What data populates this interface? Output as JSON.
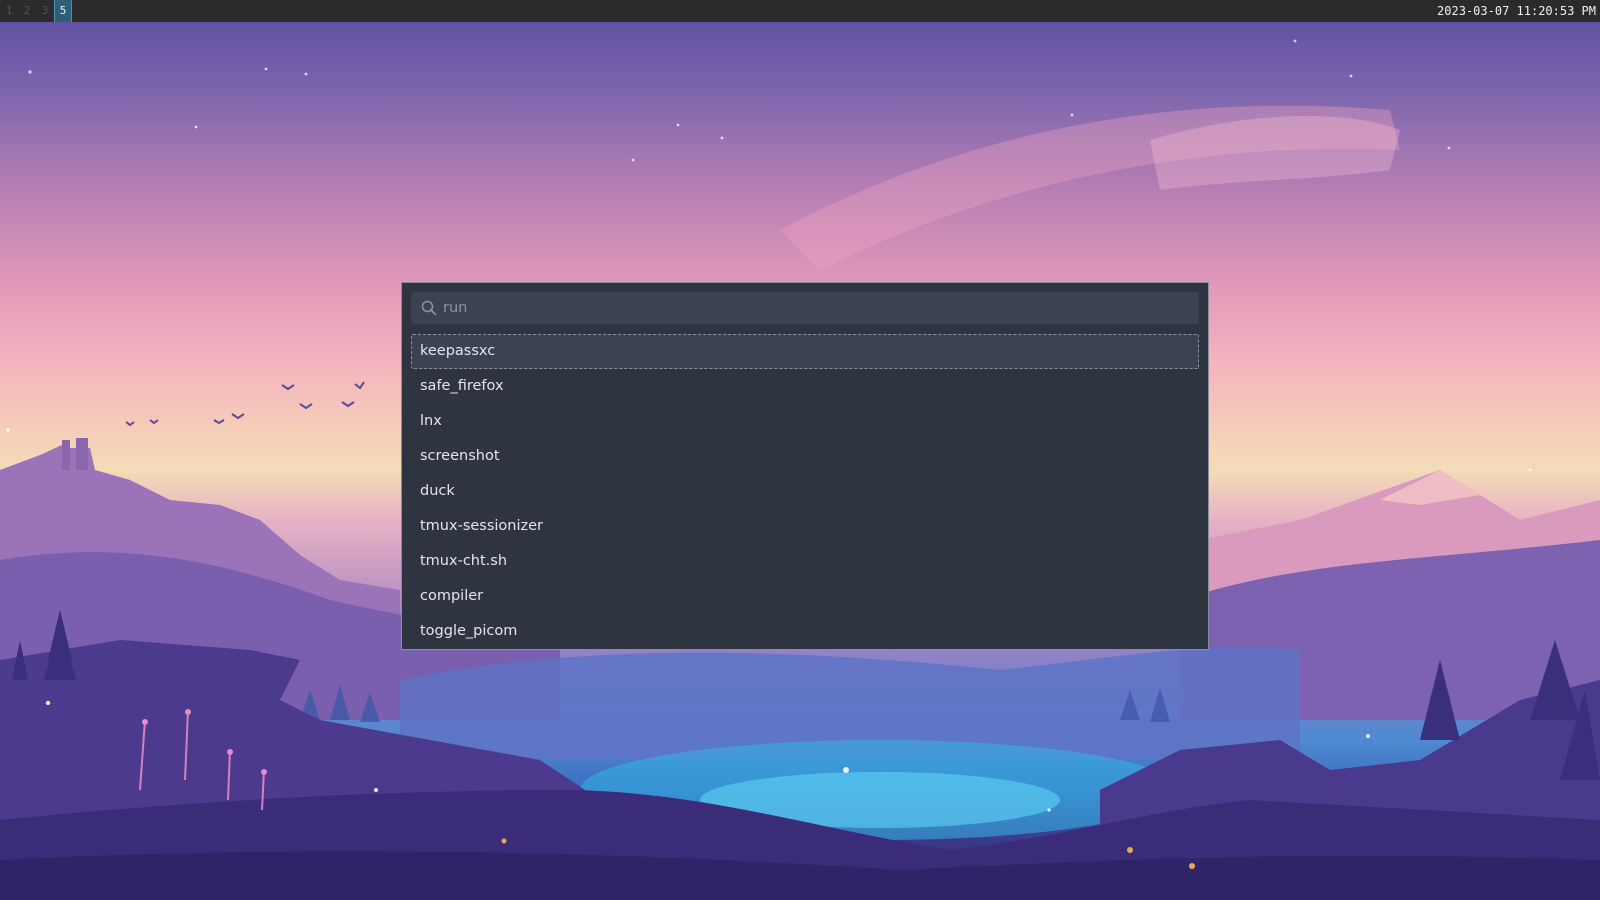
{
  "topbar": {
    "workspaces": [
      "1",
      "2",
      "3",
      "4",
      "5"
    ],
    "active_workspace": "5",
    "clock": "2023-03-07 11:20:53 PM"
  },
  "launcher": {
    "search_placeholder": "run",
    "search_value": "",
    "results": [
      {
        "label": "keepassxc",
        "selected": true
      },
      {
        "label": "safe_firefox",
        "selected": false
      },
      {
        "label": "lnx",
        "selected": false
      },
      {
        "label": "screenshot",
        "selected": false
      },
      {
        "label": "duck",
        "selected": false
      },
      {
        "label": "tmux-sessionizer",
        "selected": false
      },
      {
        "label": "tmux-cht.sh",
        "selected": false
      },
      {
        "label": "compiler",
        "selected": false
      },
      {
        "label": "toggle_picom",
        "selected": false
      }
    ]
  },
  "colors": {
    "topbar_bg": "#2b2b2b",
    "active_workspace_bg": "#2f5f78",
    "launcher_bg": "#2e3440",
    "search_bg": "#3b4250",
    "selected_bg": "#3b4252",
    "text": "#e3e6ec",
    "placeholder": "#8d93a0"
  },
  "icons": {
    "search": "search-icon"
  }
}
